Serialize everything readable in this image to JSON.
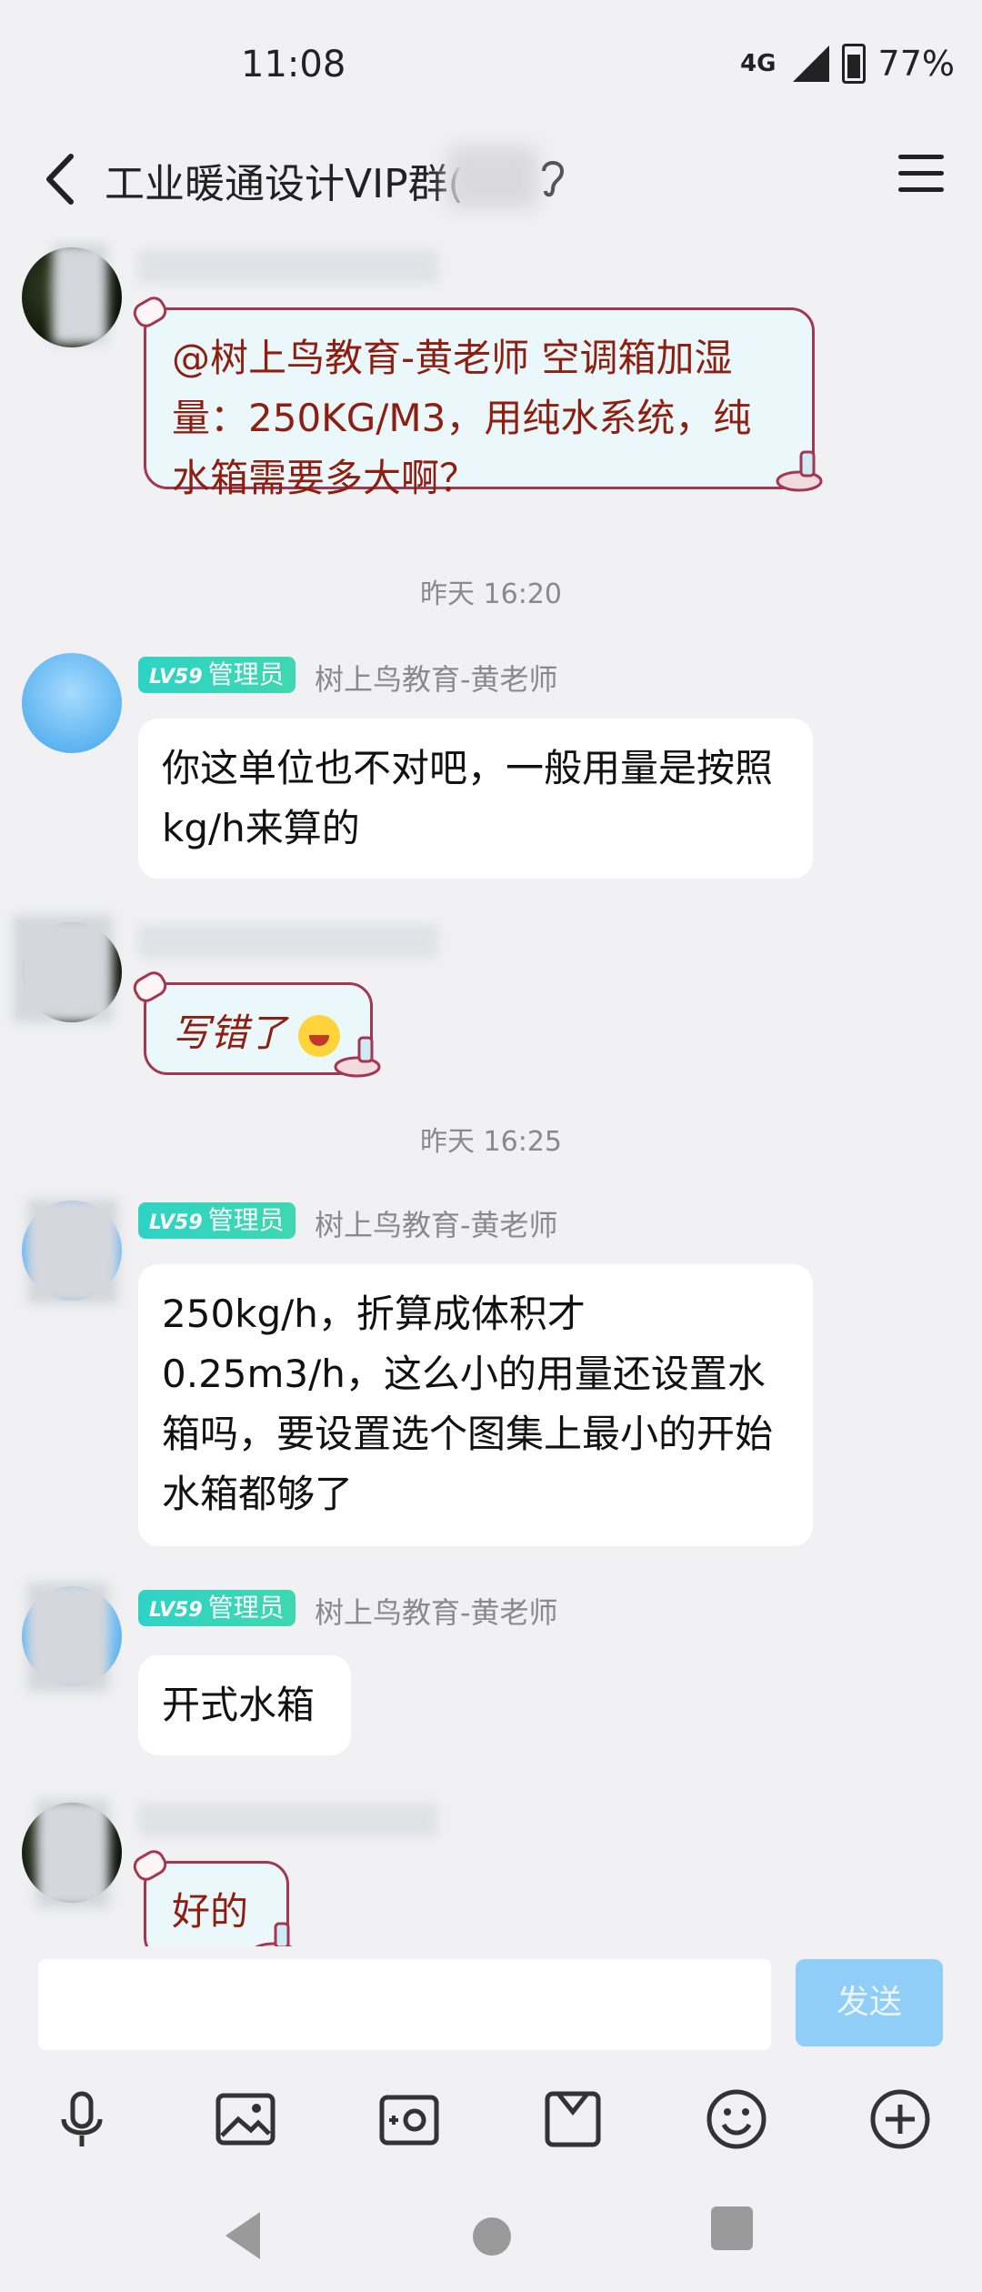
{
  "status": {
    "time": "11:08",
    "network": "4G",
    "battery": "77%"
  },
  "header": {
    "title": "工业暖通设计VIP群("
  },
  "messages": [
    {
      "text": "@树上鸟教育-黄老师 空调箱加湿量：250KG/M3，用纯水系统，纯水箱需要多大啊？"
    },
    {
      "timestamp": "昨天 16:20"
    },
    {
      "level": "LV59",
      "role": "管理员",
      "sender": "树上鸟教育-黄老师",
      "text": "你这单位也不对吧，一般用量是按照kg/h来算的"
    },
    {
      "text": "写错了"
    },
    {
      "timestamp": "昨天 16:25"
    },
    {
      "level": "LV59",
      "role": "管理员",
      "sender": "树上鸟教育-黄老师",
      "text": "250kg/h，折算成体积才0.25m3/h，这么小的用量还设置水箱吗，要设置选个图集上最小的开始水箱都够了"
    },
    {
      "level": "LV59",
      "role": "管理员",
      "sender": "树上鸟教育-黄老师",
      "text": "开式水箱"
    },
    {
      "text": "好的"
    }
  ],
  "input": {
    "send_label": "发送"
  },
  "toolbar": [
    "mic-icon",
    "image-icon",
    "camera-icon",
    "mail-icon",
    "emoji-icon",
    "plus-icon"
  ],
  "colors": {
    "accent": "#90cdf7",
    "badge": "#2ed3c5",
    "deco_border": "#a43750",
    "deco_text": "#8e1e10"
  }
}
